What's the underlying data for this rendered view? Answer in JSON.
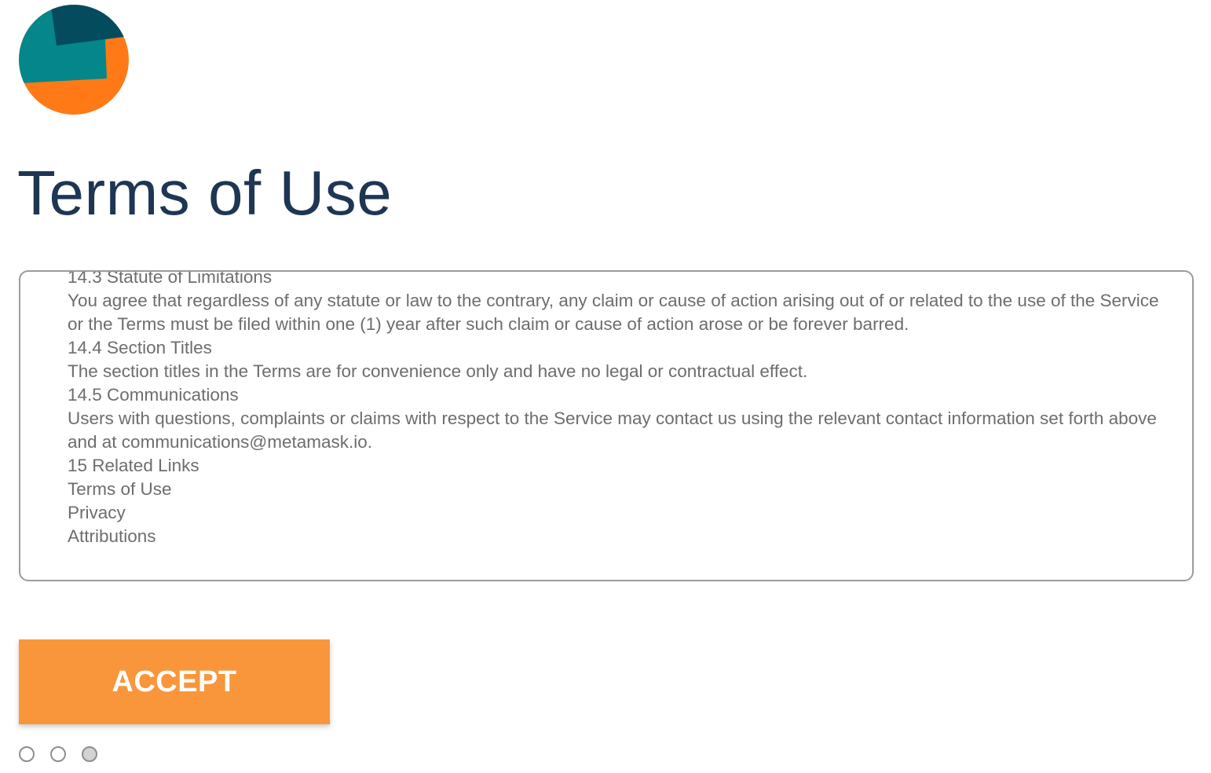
{
  "header": {
    "logo_icon": "metamask-fox-logo-icon",
    "title": "Terms of Use"
  },
  "terms": {
    "lines": [
      "14.3 Statute of Limitations",
      "You agree that regardless of any statute or law to the contrary, any claim or cause of action arising out of or related to the use of the Service or the Terms must be filed within one (1) year after such claim or cause of action arose or be forever barred.",
      "14.4 Section Titles",
      "The section titles in the Terms are for convenience only and have no legal or contractual effect.",
      "14.5 Communications",
      "Users with questions, complaints or claims with respect to the Service may contact us using the relevant contact information set forth above and at communications@metamask.io.",
      "15 Related Links",
      "Terms of Use",
      "Privacy",
      "Attributions"
    ]
  },
  "actions": {
    "accept_label": "ACCEPT"
  },
  "pagination": {
    "total": 3,
    "current": 3
  },
  "colors": {
    "title": "#1e3653",
    "accent": "#f9963b",
    "body_text": "#6d6d6d",
    "border": "#9b9b9b"
  }
}
